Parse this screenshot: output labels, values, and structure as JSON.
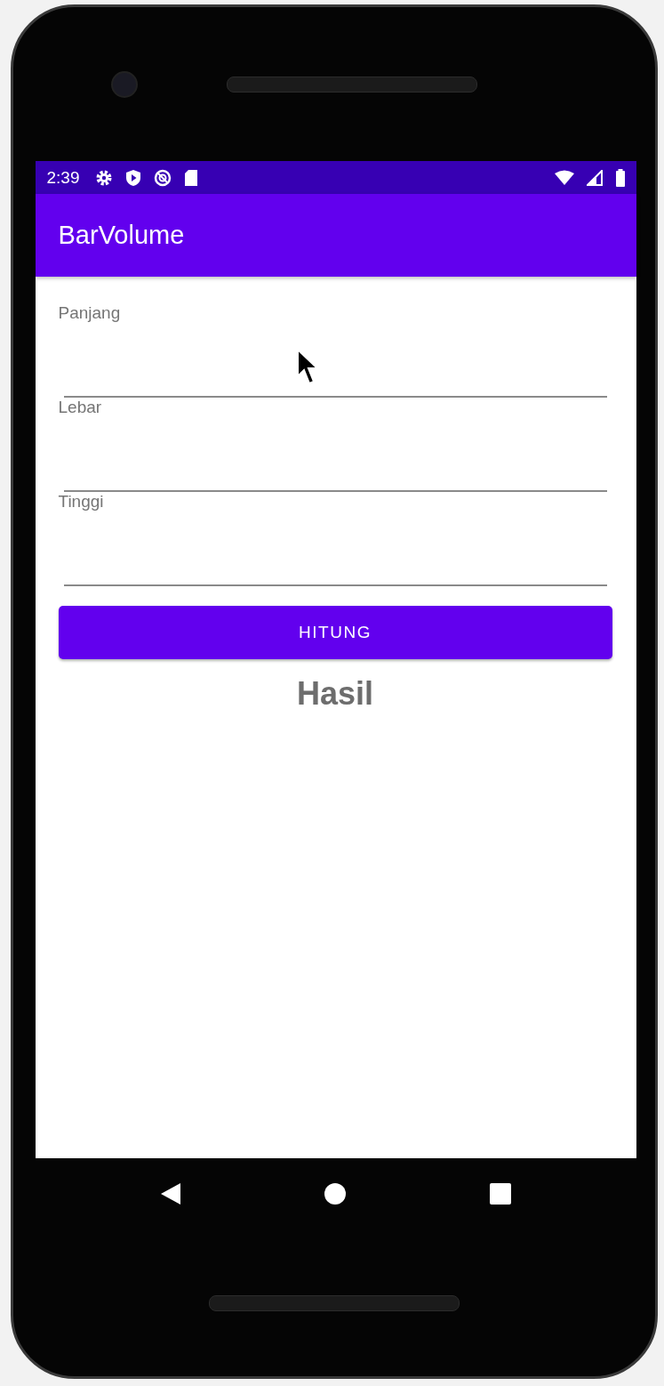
{
  "status_bar": {
    "time": "2:39"
  },
  "app_bar": {
    "title": "BarVolume"
  },
  "fields": [
    {
      "label": "Panjang"
    },
    {
      "label": "Lebar"
    },
    {
      "label": "Tinggi"
    }
  ],
  "button": {
    "label": "HITUNG"
  },
  "result": {
    "text": "Hasil"
  }
}
